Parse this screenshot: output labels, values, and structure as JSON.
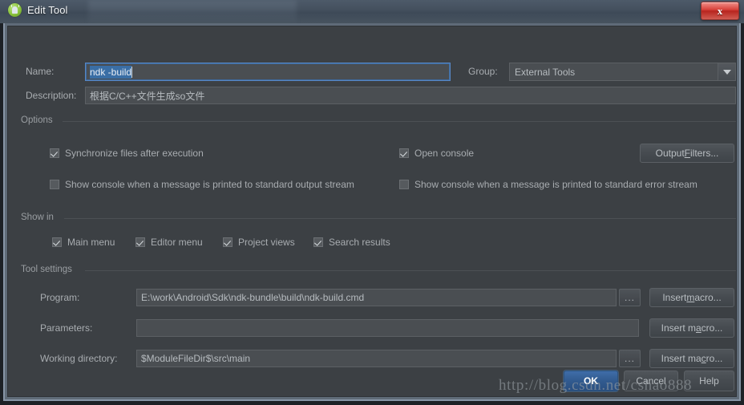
{
  "window": {
    "title": "Edit Tool",
    "app_icon": "android-studio-icon",
    "close_label": "x"
  },
  "form": {
    "name_label": "Name:",
    "name_value": "ndk -build",
    "name_selected": true,
    "description_label": "Description:",
    "description_value": "根据C/C++文件生成so文件",
    "group_label": "Group:",
    "group_value": "External Tools",
    "group_options": [
      "External Tools"
    ]
  },
  "options": {
    "title": "Options",
    "checkboxes": [
      {
        "label": "Synchronize files after execution",
        "checked": true
      },
      {
        "label": "Open console",
        "checked": true
      },
      {
        "label": "Show console when a message is printed to standard output stream",
        "checked": false
      },
      {
        "label": "Show console when a message is printed to standard error stream",
        "checked": false
      }
    ],
    "output_filters_pre": "Output ",
    "output_filters_key": "F",
    "output_filters_post": "ilters..."
  },
  "show_in": {
    "title": "Show in",
    "checkboxes": [
      {
        "label": "Main menu",
        "checked": true
      },
      {
        "label": "Editor menu",
        "checked": true
      },
      {
        "label": "Project views",
        "checked": true
      },
      {
        "label": "Search results",
        "checked": true
      }
    ]
  },
  "tool_settings": {
    "title": "Tool settings",
    "rows": [
      {
        "label": "Program:",
        "value": "E:\\work\\Android\\Sdk\\ndk-bundle\\build\\ndk-build.cmd",
        "has_browse": true,
        "browse_label": "...",
        "macro_pre": "Insert ",
        "macro_key": "m",
        "macro_post": "acro..."
      },
      {
        "label": "Parameters:",
        "value": "",
        "has_browse": false,
        "browse_label": "",
        "macro_pre": "Insert m",
        "macro_key": "a",
        "macro_post": "cro..."
      },
      {
        "label": "Working directory:",
        "value": "$ModuleFileDir$\\src\\main",
        "has_browse": true,
        "browse_label": "...",
        "macro_pre": "Insert ma",
        "macro_key": "c",
        "macro_post": "ro..."
      }
    ]
  },
  "footer": {
    "ok_label": "OK",
    "cancel_label": "Cancel",
    "help_label": "Help"
  },
  "watermark": {
    "text": "http://blog.csdn.net/cshao888"
  },
  "colors": {
    "dialog_bg": "#3c4044",
    "field_bg": "#4a4e52",
    "accent_blue": "#3a6ea5",
    "primary_button": "#315a8f",
    "close_red": "#d9443d",
    "text": "#a8acb0"
  }
}
